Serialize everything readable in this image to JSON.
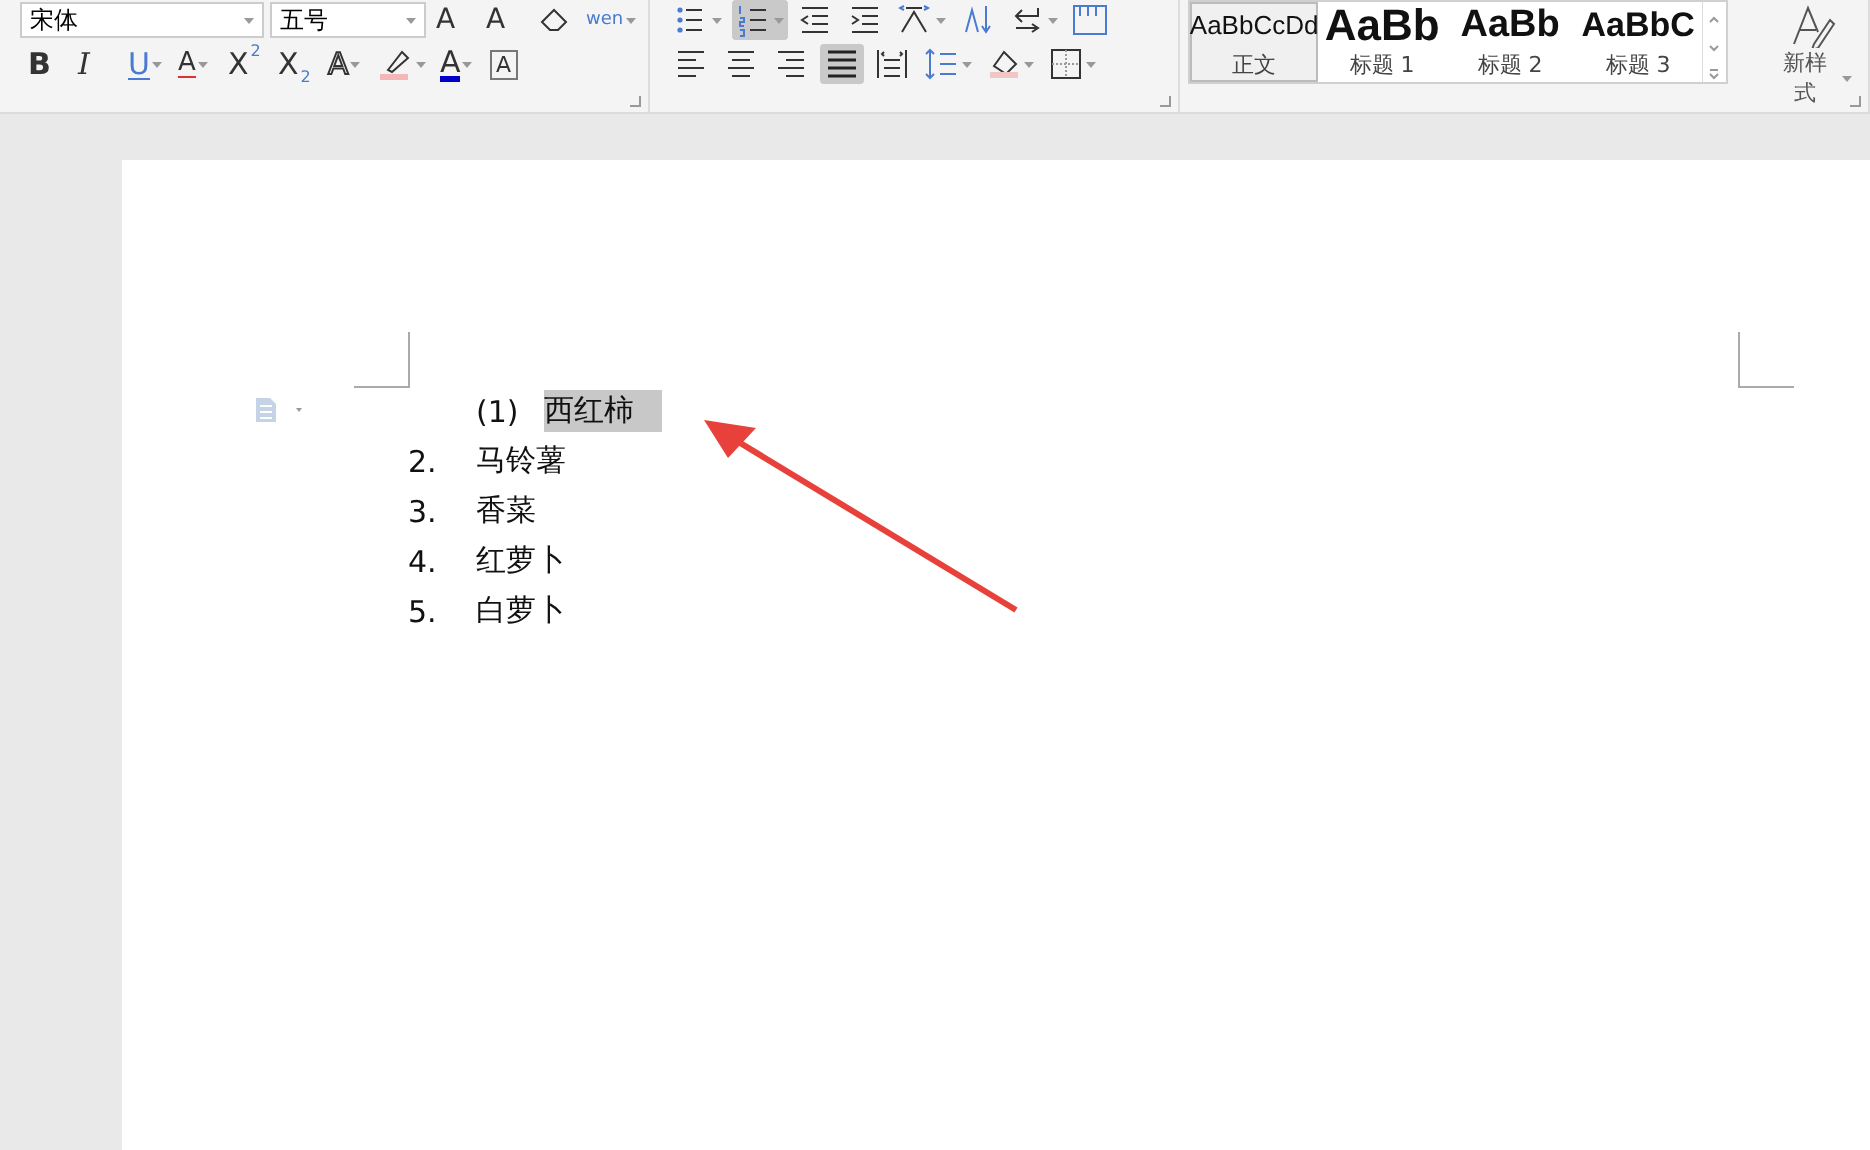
{
  "font_group": {
    "font_name": "宋体",
    "font_size": "五号",
    "row1": [
      {
        "kind": "grow-font",
        "label": "A"
      },
      {
        "kind": "shrink-font",
        "label": "A"
      },
      {
        "kind": "eraser"
      },
      {
        "kind": "phonetic",
        "label": "wen"
      }
    ],
    "row2": [
      {
        "kind": "bold",
        "label": "B"
      },
      {
        "kind": "italic",
        "label": "I"
      },
      {
        "kind": "underline",
        "label": "U"
      },
      {
        "kind": "strike",
        "label": "A"
      },
      {
        "kind": "sup",
        "label": "X",
        "index": "2"
      },
      {
        "kind": "sub",
        "label": "X",
        "index": "2"
      },
      {
        "kind": "outline",
        "label": "A"
      },
      {
        "kind": "highlighter"
      },
      {
        "kind": "font-color",
        "label": "A"
      },
      {
        "kind": "char-border",
        "label": "A"
      }
    ]
  },
  "paragraph_group": {
    "row1": [
      {
        "kind": "bullets",
        "selected": false
      },
      {
        "kind": "numbering",
        "selected": true
      },
      {
        "kind": "outdent",
        "selected": false
      },
      {
        "kind": "indent",
        "selected": false
      },
      {
        "kind": "chinese-layout",
        "selected": false
      },
      {
        "kind": "sort",
        "selected": false
      },
      {
        "kind": "line-break",
        "selected": false
      },
      {
        "kind": "ruler",
        "selected": false
      }
    ],
    "row2": [
      {
        "kind": "align-left",
        "selected": false
      },
      {
        "kind": "align-center",
        "selected": false
      },
      {
        "kind": "align-right",
        "selected": false
      },
      {
        "kind": "justify",
        "selected": true
      },
      {
        "kind": "distribute",
        "selected": false
      },
      {
        "kind": "line-spacing",
        "selected": false
      },
      {
        "kind": "shading",
        "selected": false
      },
      {
        "kind": "borders",
        "selected": false
      }
    ]
  },
  "styles": [
    {
      "preview": "AaBbCcDd",
      "label": "正文",
      "selected": true,
      "kind": "body"
    },
    {
      "preview": "AaBb",
      "label": "标题 1",
      "selected": false,
      "kind": "h1"
    },
    {
      "preview": "AaBb",
      "label": "标题 2",
      "selected": false,
      "kind": "h2"
    },
    {
      "preview": "AaBbC",
      "label": "标题 3",
      "selected": false,
      "kind": "h3"
    }
  ],
  "new_style": {
    "label": "新样式"
  },
  "document": {
    "list": [
      {
        "kind": "sub",
        "marker": "(1)",
        "text": "西红柿",
        "highlighted": true
      },
      {
        "kind": "main",
        "marker": "2.",
        "text": "马铃薯",
        "highlighted": false
      },
      {
        "kind": "main",
        "marker": "3.",
        "text": "香菜",
        "highlighted": false
      },
      {
        "kind": "main",
        "marker": "4.",
        "text": "红萝卜",
        "highlighted": false
      },
      {
        "kind": "main",
        "marker": "5.",
        "text": "白萝卜",
        "highlighted": false
      }
    ]
  }
}
